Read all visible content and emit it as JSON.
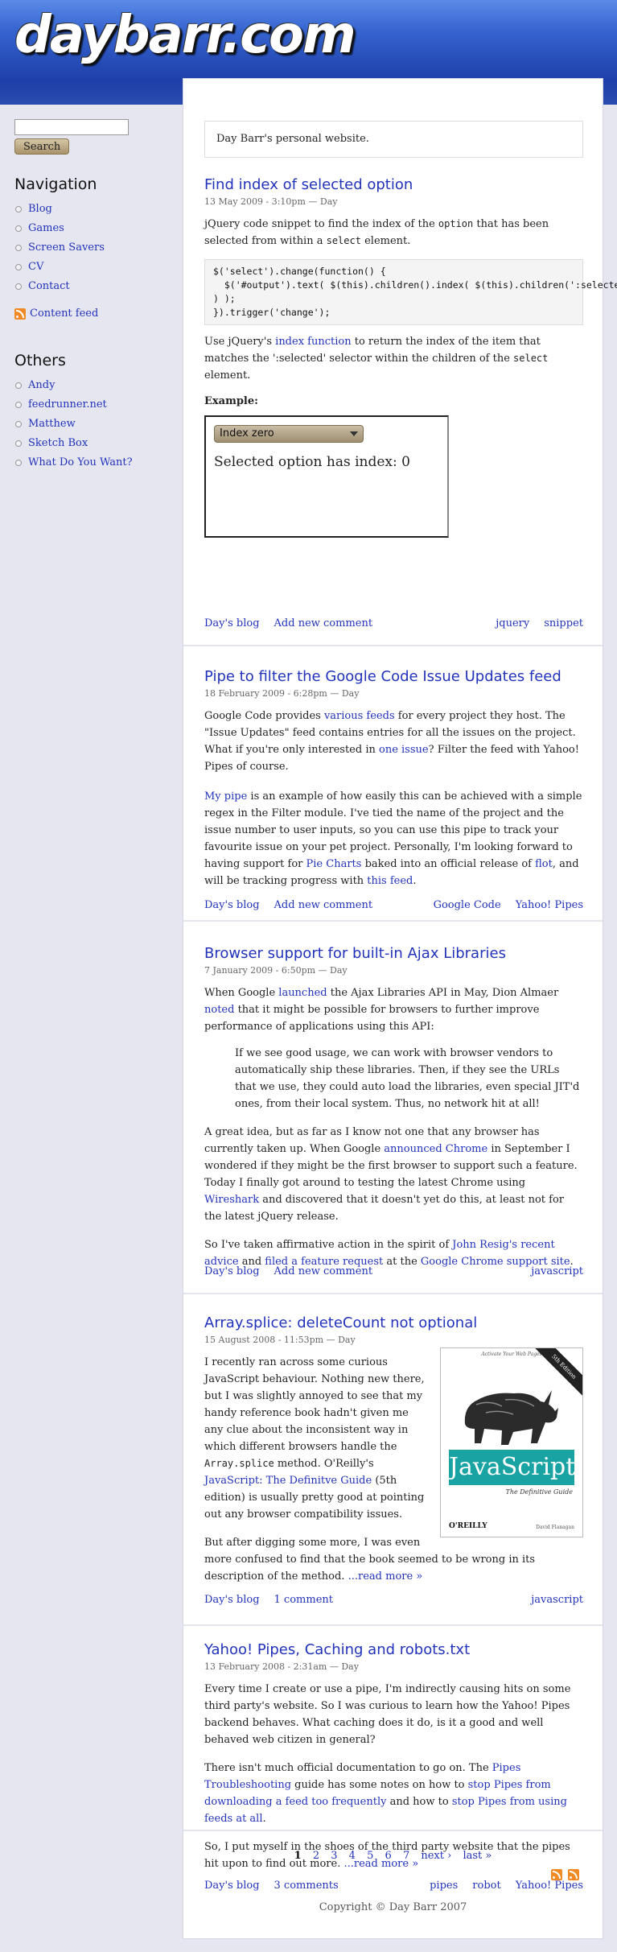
{
  "site": {
    "logo": "daybarr.com",
    "tagline": "Day Barr's personal website."
  },
  "search": {
    "placeholder": "",
    "value": "",
    "button_label": "Search"
  },
  "sidebar": {
    "navigation_heading": "Navigation",
    "nav_items": [
      {
        "label": "Blog"
      },
      {
        "label": "Games"
      },
      {
        "label": "Screen Savers"
      },
      {
        "label": "CV"
      },
      {
        "label": "Contact"
      }
    ],
    "feed_label": "Content feed",
    "others_heading": "Others",
    "others_items": [
      {
        "label": "Andy"
      },
      {
        "label": "feedrunner.net"
      },
      {
        "label": "Matthew"
      },
      {
        "label": "Sketch Box"
      },
      {
        "label": "What Do You Want?"
      }
    ]
  },
  "posts": [
    {
      "title": "Find index of selected option",
      "date": "13 May 2009 - 3:10pm — Day",
      "p1a": "jQuery code snippet to find the index of the ",
      "p1code": "option",
      "p1b": " that has been selected from within a ",
      "p1code2": "select",
      "p1c": " element.",
      "code": "$('select').change(function() {\n  $('#output').text( $(this).children().index( $(this).children(':selected')\n) );\n}).trigger('change');",
      "p2a": "Use jQuery's ",
      "p2link": "index function",
      "p2b": " to return the index of the item that matches the ':selected' selector within the children of the ",
      "p2code": "select",
      "p2c": " element.",
      "example_label": "Example:",
      "select_value": "Index zero",
      "example_output": "Selected option has index: 0",
      "footer_left": [
        "Day's blog",
        "Add new comment"
      ],
      "tags": [
        "jquery",
        "snippet"
      ]
    },
    {
      "title": "Pipe to filter the Google Code Issue Updates feed",
      "date": "18 February 2009 - 6:28pm — Day",
      "p1a": "Google Code provides ",
      "p1link1": "various feeds",
      "p1b": " for every project they host. The \"Issue Updates\" feed contains entries for all the issues on the project. What if you're only interested in ",
      "p1link2": "one issue",
      "p1c": "? Filter the feed with Yahoo! Pipes of course.",
      "p2link1": "My pipe",
      "p2a": " is an example of how easily this can be achieved with a simple regex in the Filter module. I've tied the name of the project and the issue number to user inputs, so you can use this pipe to track your favourite issue on your pet project. Personally, I'm looking forward to having support for ",
      "p2link2": "Pie Charts",
      "p2b": " baked into an official release of ",
      "p2link3": "flot",
      "p2c": ", and will be tracking progress with ",
      "p2link4": "this feed",
      "p2d": ".",
      "footer_left": [
        "Day's blog",
        "Add new comment"
      ],
      "tags": [
        "Google Code",
        "Yahoo! Pipes"
      ]
    },
    {
      "title": "Browser support for built-in Ajax Libraries",
      "date": "7 January 2009 - 6:50pm — Day",
      "p1a": "When Google ",
      "p1link1": "launched",
      "p1b": " the Ajax Libraries API in May, Dion Almaer ",
      "p1link2": "noted",
      "p1c": " that it might be possible for browsers to further improve performance of applications using this API:",
      "quote": "If we see good usage, we can work with browser vendors to automatically ship these libraries. Then, if they see the URLs that we use, they could auto load the libraries, even special JIT'd ones, from their local system. Thus, no network hit at all!",
      "p2a": "A great idea, but as far as I know not one that any browser has currently taken up. When Google ",
      "p2link1": "announced Chrome",
      "p2b": " in September I wondered if they might be the first browser to support such a feature. Today I finally got around to testing the latest Chrome using ",
      "p2link2": "Wireshark",
      "p2c": " and discovered that it doesn't yet do this, at least not for the latest jQuery release.",
      "p3a": "So I've taken affirmative action in the spirit of ",
      "p3link1": "John Resig's recent advice",
      "p3b": " and ",
      "p3link2": "filed a feature request",
      "p3c": " at the ",
      "p3link3": "Google Chrome support site",
      "p3d": ".",
      "footer_left": [
        "Day's blog",
        "Add new comment"
      ],
      "tags": [
        "javascript"
      ]
    },
    {
      "title": "Array.splice: deleteCount not optional",
      "date": "15 August 2008 - 11:53pm — Day",
      "p1a": "I recently ran across some curious JavaScript behaviour. Nothing new there, but I was slightly annoyed to see that my handy reference book hadn't given me any clue about the inconsistent way in which different browsers handle the ",
      "p1code": "Array.splice",
      "p1b": " method. O'Reilly's ",
      "p1link": "JavaScript: The Definitve Guide",
      "p1c": " (5th edition) is usually pretty good at pointing out any browser compatibility issues.",
      "p2a": "But after digging some more, I was even more confused to find that the book seemed to be wrong in its description of the method.  ",
      "read_more": "...read more »",
      "book": {
        "top": "Activate Your Web Pages",
        "corner": "5th Edition",
        "title": "JavaScript",
        "subtitle": "The Definitive Guide",
        "publisher": "O'REILLY",
        "author": "David Flanagan"
      },
      "footer_left": [
        "Day's blog",
        "1 comment"
      ],
      "tags": [
        "javascript"
      ]
    },
    {
      "title": "Yahoo! Pipes, Caching and robots.txt",
      "date": "13 February 2008 - 2:31am — Day",
      "p1": "Every time I create or use a pipe, I'm indirectly causing hits on some third party's website.  So I was curious to learn how the Yahoo! Pipes backend behaves.  What caching does it do, is it a good and well behaved web citizen in general?",
      "p2a": "There isn't much official documentation to go on.  The ",
      "p2link1": "Pipes Troubleshooting",
      "p2b": " guide has some notes on how to ",
      "p2link2": "stop Pipes from downloading a feed too frequently",
      "p2c": " and how to ",
      "p2link3": "stop Pipes from using feeds at all",
      "p2d": ".",
      "p3a": "So, I put myself in the shoes of the third party website that the pipes hit upon to find out more.  ",
      "read_more": "...read more »",
      "footer_left": [
        "Day's blog",
        "3 comments"
      ],
      "tags": [
        "pipes",
        "robot",
        "Yahoo! Pipes"
      ]
    }
  ],
  "pager": {
    "current": "1",
    "pages": [
      "2",
      "3",
      "4",
      "5",
      "6",
      "7"
    ],
    "next": "next ›",
    "last": "last »"
  },
  "copyright": "Copyright © Day Barr 2007",
  "colors": {
    "link": "#2233bb",
    "header_top": "#5a8be8",
    "header_bottom": "#1e3fa8",
    "rss": "#f08a24"
  }
}
